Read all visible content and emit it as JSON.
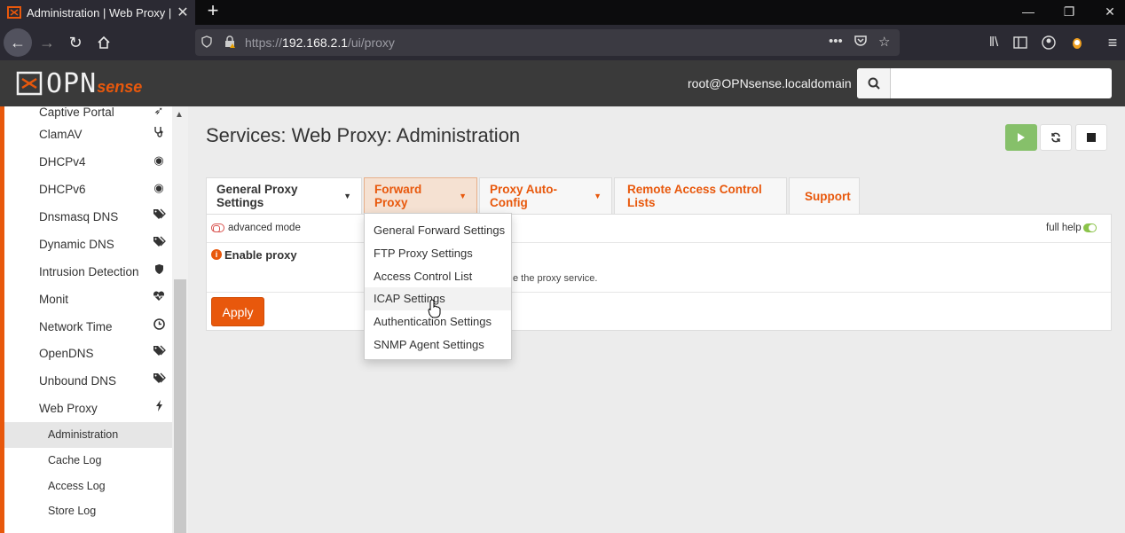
{
  "browser": {
    "tab_title": "Administration | Web Proxy | Se",
    "url_prefix": "https://",
    "url_host": "192.168.2.1",
    "url_path": "/ui/proxy"
  },
  "app": {
    "logo_opn": "OPN",
    "logo_sense": "sense",
    "user": "root@OPNsense.localdomain",
    "search_value": ""
  },
  "sidebar": {
    "items": [
      {
        "label": "Captive Portal",
        "icon": "send-icon"
      },
      {
        "label": "ClamAV",
        "icon": "stethoscope-icon"
      },
      {
        "label": "DHCPv4",
        "icon": "bullseye-icon"
      },
      {
        "label": "DHCPv6",
        "icon": "bullseye-icon"
      },
      {
        "label": "Dnsmasq DNS",
        "icon": "tags-icon"
      },
      {
        "label": "Dynamic DNS",
        "icon": "tags-icon"
      },
      {
        "label": "Intrusion Detection",
        "icon": "shield-icon"
      },
      {
        "label": "Monit",
        "icon": "heartbeat-icon"
      },
      {
        "label": "Network Time",
        "icon": "clock-icon"
      },
      {
        "label": "OpenDNS",
        "icon": "tags-icon"
      },
      {
        "label": "Unbound DNS",
        "icon": "tags-icon"
      },
      {
        "label": "Web Proxy",
        "icon": "bolt-icon"
      }
    ],
    "subitems": [
      {
        "label": "Administration",
        "active": true
      },
      {
        "label": "Cache Log",
        "active": false
      },
      {
        "label": "Access Log",
        "active": false
      },
      {
        "label": "Store Log",
        "active": false
      }
    ]
  },
  "page": {
    "title": "Services: Web Proxy: Administration"
  },
  "tabs": [
    {
      "label": "General Proxy Settings",
      "caret": true
    },
    {
      "label": "Forward Proxy",
      "caret": true
    },
    {
      "label": "Proxy Auto-Config",
      "caret": true
    },
    {
      "label": "Remote Access Control Lists",
      "caret": false
    },
    {
      "label": "Support",
      "caret": false
    }
  ],
  "panel": {
    "advanced_mode": "advanced mode",
    "full_help": "full help",
    "enable_proxy": "Enable proxy",
    "enable_help_fragment": "e the proxy service.",
    "apply": "Apply"
  },
  "dropdown": {
    "items": [
      "General Forward Settings",
      "FTP Proxy Settings",
      "Access Control List",
      "ICAP Settings",
      "Authentication Settings",
      "SNMP Agent Settings"
    ],
    "hovered_index": 3
  },
  "colors": {
    "accent": "#e8580c",
    "play_green": "#86c06a",
    "header_bg": "#3a3a3a"
  }
}
